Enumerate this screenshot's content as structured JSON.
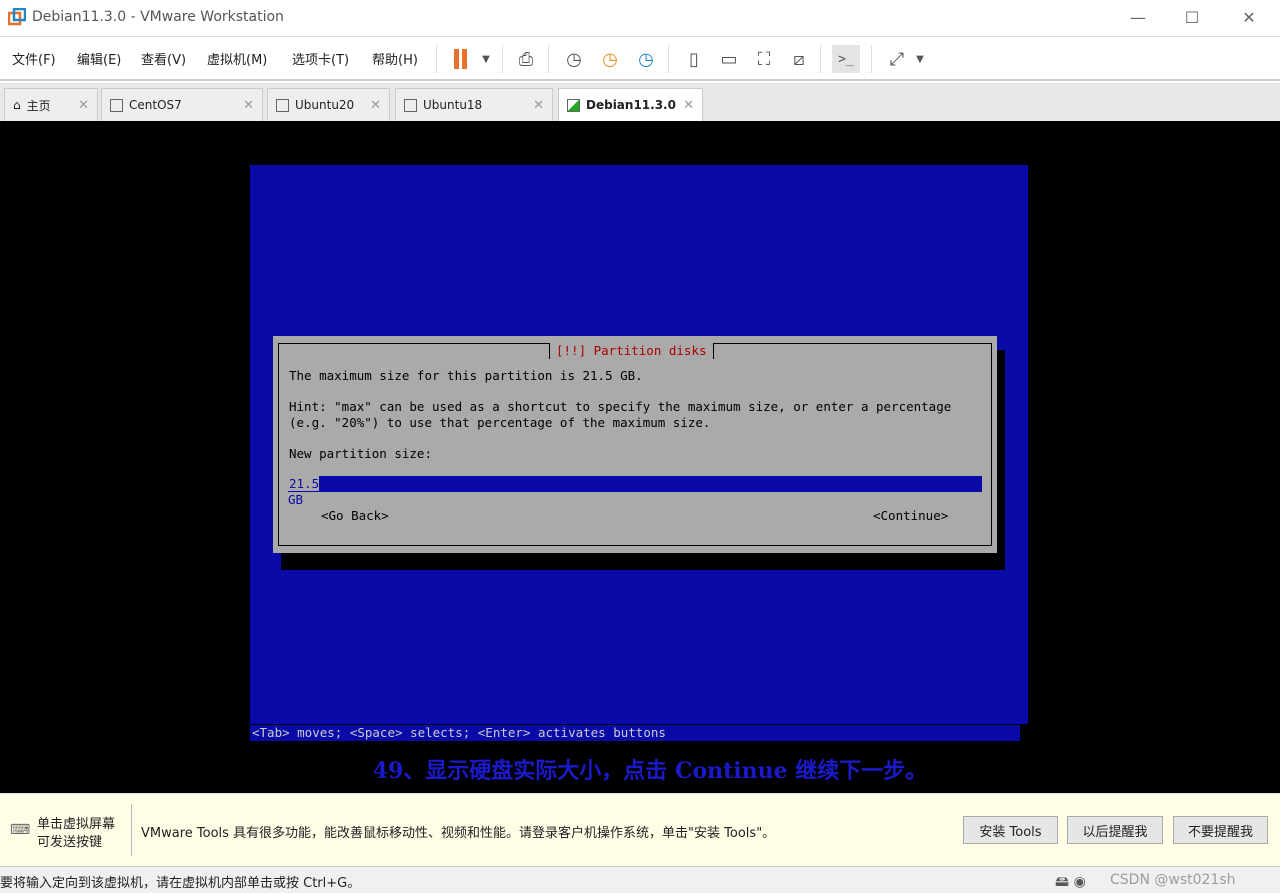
{
  "window": {
    "title": "Debian11.3.0 - VMware Workstation",
    "minimize": "—",
    "maximize": "☐",
    "close": "✕"
  },
  "menu": [
    "文件(F)",
    "编辑(E)",
    "查看(V)",
    "虚拟机(M)",
    "选项卡(T)",
    "帮助(H)"
  ],
  "toolbar_icons": [
    "pause-icon",
    "dropdown-icon",
    "send-keys-icon",
    "snapshot-take-icon",
    "snapshot-revert-icon",
    "snapshot-manager-icon",
    "sidebar-icon",
    "thumbnail-bar-icon",
    "fullscreen-icon",
    "unity-icon",
    "console-icon",
    "stretch-icon",
    "dropdown-icon"
  ],
  "tabs": [
    {
      "label": "主页"
    },
    {
      "label": "CentOS7"
    },
    {
      "label": "Ubuntu20"
    },
    {
      "label": "Ubuntu18"
    },
    {
      "label": "Debian11.3.0",
      "active": true
    }
  ],
  "installer": {
    "title": "[!!] Partition disks",
    "line1": "The maximum size for this partition is 21.5 GB.",
    "hint1": "Hint: \"max\" can be used as a shortcut to specify the maximum size, or enter a percentage",
    "hint2": "(e.g. \"20%\") to use that percentage of the maximum size.",
    "prompt": "New partition size:",
    "value": "21.5 GB",
    "go_back": "<Go Back>",
    "continue": "<Continue>",
    "help": "<Tab> moves; <Space> selects; <Enter> activates buttons"
  },
  "caption": "49、显示硬盘实际大小，点击 Continue 继续下一步。",
  "notify": {
    "left1": "单击虚拟屏幕",
    "left2": "可发送按键",
    "message": "VMware Tools 具有很多功能，能改善鼠标移动性、视频和性能。请登录客户机操作系统，单击\"安装 Tools\"。",
    "install": "安装 Tools",
    "later": "以后提醒我",
    "never": "不要提醒我"
  },
  "status": {
    "text": "要将输入定向到该虚拟机，请在虚拟机内部单击或按 Ctrl+G。",
    "watermark": "CSDN @wst021sh"
  },
  "colors": {
    "installer_bg": "#0a0aa8",
    "dialog_bg": "#aaaaaa",
    "title_red": "#aa0000",
    "pause_orange": "#e8702a",
    "caption_blue": "#1a1acc"
  }
}
